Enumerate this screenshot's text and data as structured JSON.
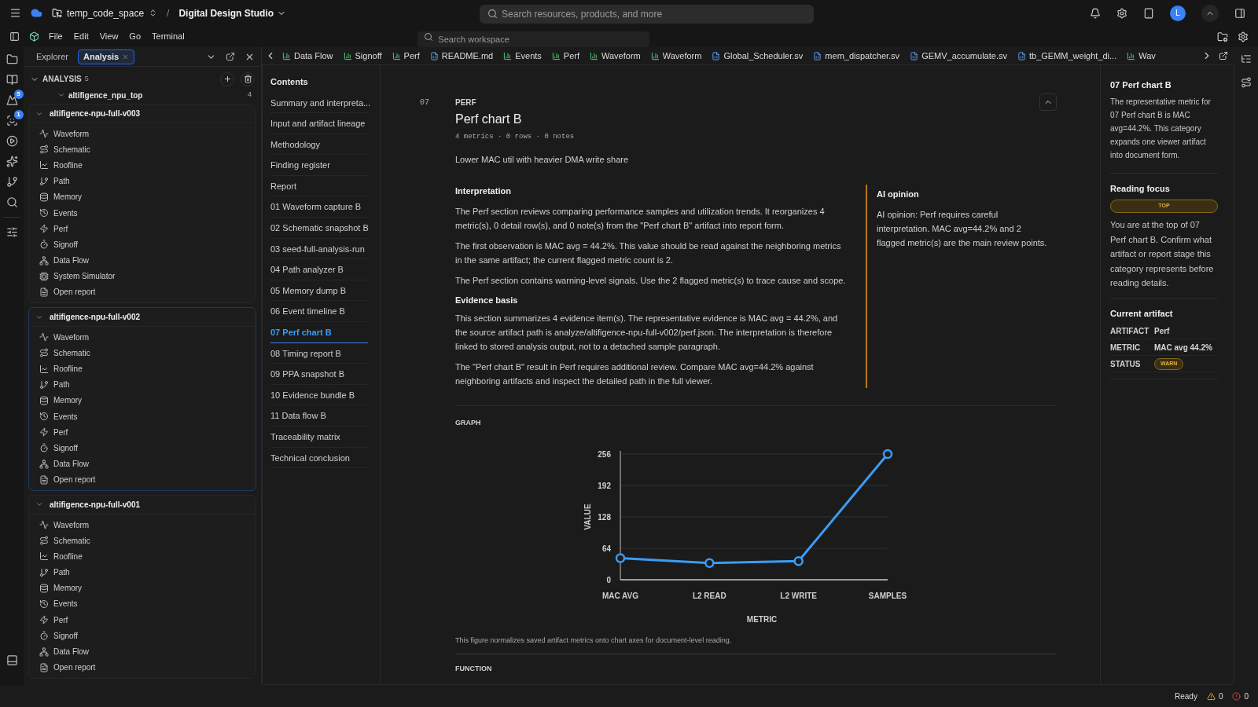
{
  "topbar": {
    "workspace": "temp_code_space",
    "separator": "/",
    "project": "Digital Design Studio",
    "search": {
      "placeholder": "Search resources, products, and more"
    },
    "avatar": "L"
  },
  "menubar": {
    "menus": [
      "File",
      "Edit",
      "View",
      "Go",
      "Terminal"
    ],
    "search": {
      "placeholder": "Search workspace"
    }
  },
  "activity_bar": [
    {
      "kind": "folder"
    },
    {
      "kind": "book"
    },
    {
      "kind": "mountain",
      "badge": "5"
    },
    {
      "kind": "face",
      "badge": "1"
    },
    {
      "kind": "play"
    },
    {
      "kind": "sparkles"
    },
    {
      "kind": "branch"
    },
    {
      "kind": "search"
    },
    {
      "kind": "sliders"
    }
  ],
  "sidebar": {
    "tabs": [
      {
        "label": "Explorer",
        "selected": false,
        "closable": false
      },
      {
        "label": "Analysis",
        "selected": true,
        "closable": true
      }
    ],
    "section": {
      "title": "ANALYSIS",
      "count": "5",
      "expanded": true
    },
    "root": {
      "label": "altifigence_npu_top",
      "count": "4",
      "expanded": true
    },
    "groups": [
      {
        "label": "altifigence-npu-full-v003",
        "expanded": true,
        "selected": false,
        "items": [
          {
            "label": "Waveform",
            "kind": "waveform"
          },
          {
            "label": "Schematic",
            "kind": "schematic"
          },
          {
            "label": "Roofline",
            "kind": "roofline"
          },
          {
            "label": "Path",
            "kind": "path"
          },
          {
            "label": "Memory",
            "kind": "memory"
          },
          {
            "label": "Events",
            "kind": "events"
          },
          {
            "label": "Perf",
            "kind": "perf"
          },
          {
            "label": "Signoff",
            "kind": "signoff"
          },
          {
            "label": "Data Flow",
            "kind": "dataflow"
          },
          {
            "label": "System Simulator",
            "kind": "simulator"
          },
          {
            "label": "Open report",
            "kind": "report"
          }
        ]
      },
      {
        "label": "altifigence-npu-full-v002",
        "expanded": true,
        "selected": true,
        "items": [
          {
            "label": "Waveform",
            "kind": "waveform"
          },
          {
            "label": "Schematic",
            "kind": "schematic"
          },
          {
            "label": "Roofline",
            "kind": "roofline"
          },
          {
            "label": "Path",
            "kind": "path"
          },
          {
            "label": "Memory",
            "kind": "memory"
          },
          {
            "label": "Events",
            "kind": "events"
          },
          {
            "label": "Perf",
            "kind": "perf"
          },
          {
            "label": "Signoff",
            "kind": "signoff"
          },
          {
            "label": "Data Flow",
            "kind": "dataflow"
          },
          {
            "label": "Open report",
            "kind": "report"
          }
        ]
      },
      {
        "label": "altifigence-npu-full-v001",
        "expanded": true,
        "selected": false,
        "items": [
          {
            "label": "Waveform",
            "kind": "waveform"
          },
          {
            "label": "Schematic",
            "kind": "schematic"
          },
          {
            "label": "Roofline",
            "kind": "roofline"
          },
          {
            "label": "Path",
            "kind": "path"
          },
          {
            "label": "Memory",
            "kind": "memory"
          },
          {
            "label": "Events",
            "kind": "events"
          },
          {
            "label": "Perf",
            "kind": "perf"
          },
          {
            "label": "Signoff",
            "kind": "signoff"
          },
          {
            "label": "Data Flow",
            "kind": "dataflow"
          },
          {
            "label": "Open report",
            "kind": "report"
          }
        ]
      }
    ]
  },
  "editor_tabs": [
    {
      "label": "Data Flow",
      "kind": "chart"
    },
    {
      "label": "Signoff",
      "kind": "chart"
    },
    {
      "label": "Perf",
      "kind": "chart"
    },
    {
      "label": "README.md",
      "kind": "file"
    },
    {
      "label": "Events",
      "kind": "chart"
    },
    {
      "label": "Perf",
      "kind": "chart"
    },
    {
      "label": "Waveform",
      "kind": "chart"
    },
    {
      "label": "Waveform",
      "kind": "chart"
    },
    {
      "label": "Global_Scheduler.sv",
      "kind": "file"
    },
    {
      "label": "mem_dispatcher.sv",
      "kind": "file"
    },
    {
      "label": "GEMV_accumulate.sv",
      "kind": "file"
    },
    {
      "label": "tb_GEMM_weight_di...",
      "kind": "file"
    },
    {
      "label": "Wav",
      "kind": "chart"
    }
  ],
  "contents": {
    "title": "Contents",
    "items": [
      {
        "label": "Summary and interpreta...",
        "selected": false
      },
      {
        "label": "Input and artifact lineage",
        "selected": false
      },
      {
        "label": "Methodology",
        "selected": false
      },
      {
        "label": "Finding register",
        "selected": false
      },
      {
        "label": "Report",
        "selected": false
      },
      {
        "label": "01 Waveform capture B",
        "selected": false
      },
      {
        "label": "02 Schematic snapshot B",
        "selected": false
      },
      {
        "label": "03 seed-full-analysis-run",
        "selected": false
      },
      {
        "label": "04 Path analyzer B",
        "selected": false
      },
      {
        "label": "05 Memory dump B",
        "selected": false
      },
      {
        "label": "06 Event timeline B",
        "selected": false
      },
      {
        "label": "07 Perf chart B",
        "selected": true
      },
      {
        "label": "08 Timing report B",
        "selected": false
      },
      {
        "label": "09 PPA snapshot B",
        "selected": false
      },
      {
        "label": "10 Evidence bundle B",
        "selected": false
      },
      {
        "label": "11 Data flow B",
        "selected": false
      },
      {
        "label": "Traceability matrix",
        "selected": false
      },
      {
        "label": "Technical conclusion",
        "selected": false
      }
    ]
  },
  "section": {
    "number": "07",
    "category": "PERF",
    "title": "Perf chart B",
    "meta": "4 metrics · 0 rows · 0 notes",
    "summary": "Lower MAC util with heavier DMA write share",
    "interpretation": {
      "title": "Interpretation",
      "paragraphs": [
        "The Perf section reviews comparing performance samples and utilization trends. It reorganizes 4 metric(s), 0 detail row(s), and 0 note(s) from the \"Perf chart B\" artifact into report form.",
        "The first observation is MAC avg = 44.2%. This value should be read against the neighboring metrics in the same artifact; the current flagged metric count is 2.",
        "The Perf section contains warning-level signals. Use the 2 flagged metric(s) to trace cause and scope."
      ]
    },
    "evidence": {
      "title": "Evidence basis",
      "paragraphs": [
        "This section summarizes 4 evidence item(s). The representative evidence is MAC avg = 44.2%, and the source artifact path is analyze/altifigence-npu-full-v002/perf.json. The interpretation is therefore linked to stored analysis output, not to a detached sample paragraph.",
        "The \"Perf chart B\" result in Perf requires additional review. Compare MAC avg=44.2% against neighboring artifacts and inspect the detailed path in the full viewer."
      ]
    },
    "ai_opinion": {
      "title": "AI opinion",
      "text": "AI opinion: Perf requires careful interpretation. MAC avg=44.2% and 2 flagged metric(s) are the main review points."
    },
    "graph": {
      "title": "GRAPH",
      "caption": "This figure normalizes saved artifact metrics onto chart axes for document-level reading.",
      "chart_data": {
        "type": "line",
        "xlabel": "METRIC",
        "ylabel": "VALUE",
        "categories": [
          "MAC AVG",
          "L2 READ",
          "L2 WRITE",
          "SAMPLES"
        ],
        "series": [
          {
            "color": "#3b9cf5",
            "marker": "circle",
            "values": [
              44,
              34,
              38,
              256
            ]
          }
        ],
        "grid": true,
        "ylim": [
          0,
          256
        ],
        "yticks": [
          0,
          64,
          128,
          192,
          256
        ]
      }
    },
    "next_heading": "FUNCTION"
  },
  "rail": {
    "title": "07 Perf chart B",
    "text": "The representative metric for 07 Perf chart B is MAC avg=44.2%. This category expands one viewer artifact into document form.",
    "focus": {
      "title": "Reading focus",
      "badge": "TOP",
      "text": "You are at the top of 07 Perf chart B. Confirm what artifact or report stage this category represents before reading details."
    },
    "artifact": {
      "title": "Current artifact",
      "rows": [
        {
          "key": "ARTIFACT",
          "value": "Perf",
          "kind": "text"
        },
        {
          "key": "METRIC",
          "value": "MAC avg 44.2%",
          "kind": "text"
        },
        {
          "key": "STATUS",
          "value": "WARN",
          "kind": "badge"
        }
      ]
    }
  },
  "status_bar": {
    "text": "Ready",
    "warnings": "0",
    "errors": "0"
  }
}
